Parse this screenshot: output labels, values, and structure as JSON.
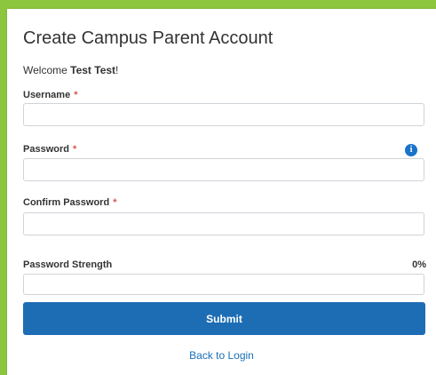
{
  "page": {
    "title": "Create Campus Parent Account",
    "welcome_prefix": "Welcome ",
    "welcome_name": "Test Test",
    "welcome_suffix": "!"
  },
  "form": {
    "username": {
      "label": "Username",
      "required_mark": "*",
      "value": ""
    },
    "password": {
      "label": "Password",
      "required_mark": "*",
      "value": "",
      "info_icon": "info-circle-icon",
      "info_glyph": "i"
    },
    "confirm_password": {
      "label": "Confirm Password",
      "required_mark": "*",
      "value": ""
    },
    "password_strength": {
      "label": "Password Strength",
      "percent_text": "0%",
      "value_fraction": 0
    },
    "submit_label": "Submit",
    "back_link": "Back to Login"
  },
  "colors": {
    "background": "#8cc63f",
    "primary": "#1d6db5",
    "required": "#d9534f",
    "info": "#1a73c9",
    "link": "#1a6fb8"
  }
}
